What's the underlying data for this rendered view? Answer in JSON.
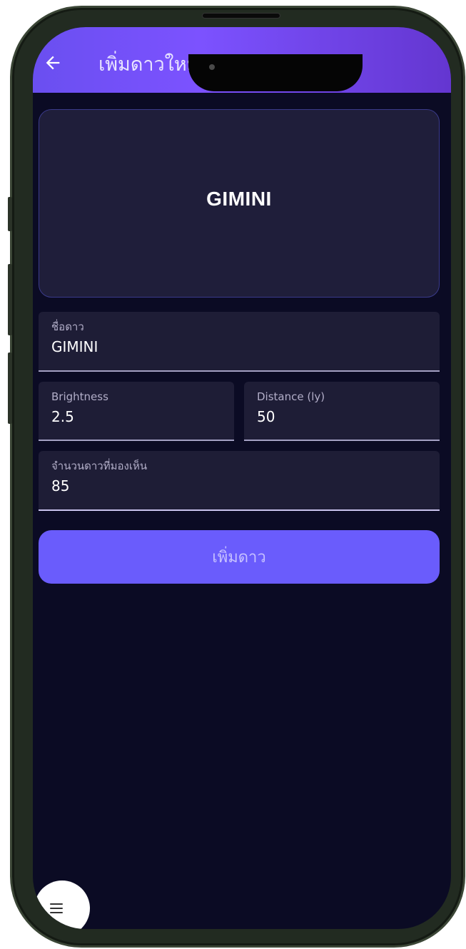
{
  "app_bar": {
    "title": "เพิ่มดาวใหม่",
    "back_icon": "arrow-left-icon"
  },
  "preview": {
    "name": "GIMINI"
  },
  "form": {
    "name": {
      "label": "ชื่อดาว",
      "value": "GIMINI"
    },
    "brightness": {
      "label": "Brightness",
      "value": "2.5"
    },
    "distance": {
      "label": "Distance (ly)",
      "value": "50"
    },
    "visible_count": {
      "label": "จำนวนดาวที่มองเห็น",
      "value": "85"
    }
  },
  "add_button": {
    "label": "เพิ่มดาว"
  },
  "menu": {
    "icon": "hamburger-menu-icon"
  },
  "colors": {
    "app_bar_start": "#6a4ff0",
    "app_bar_end": "#6436d0",
    "background": "#0b0b24",
    "card": "#1f1e3a",
    "button": "#6a5cfc"
  }
}
